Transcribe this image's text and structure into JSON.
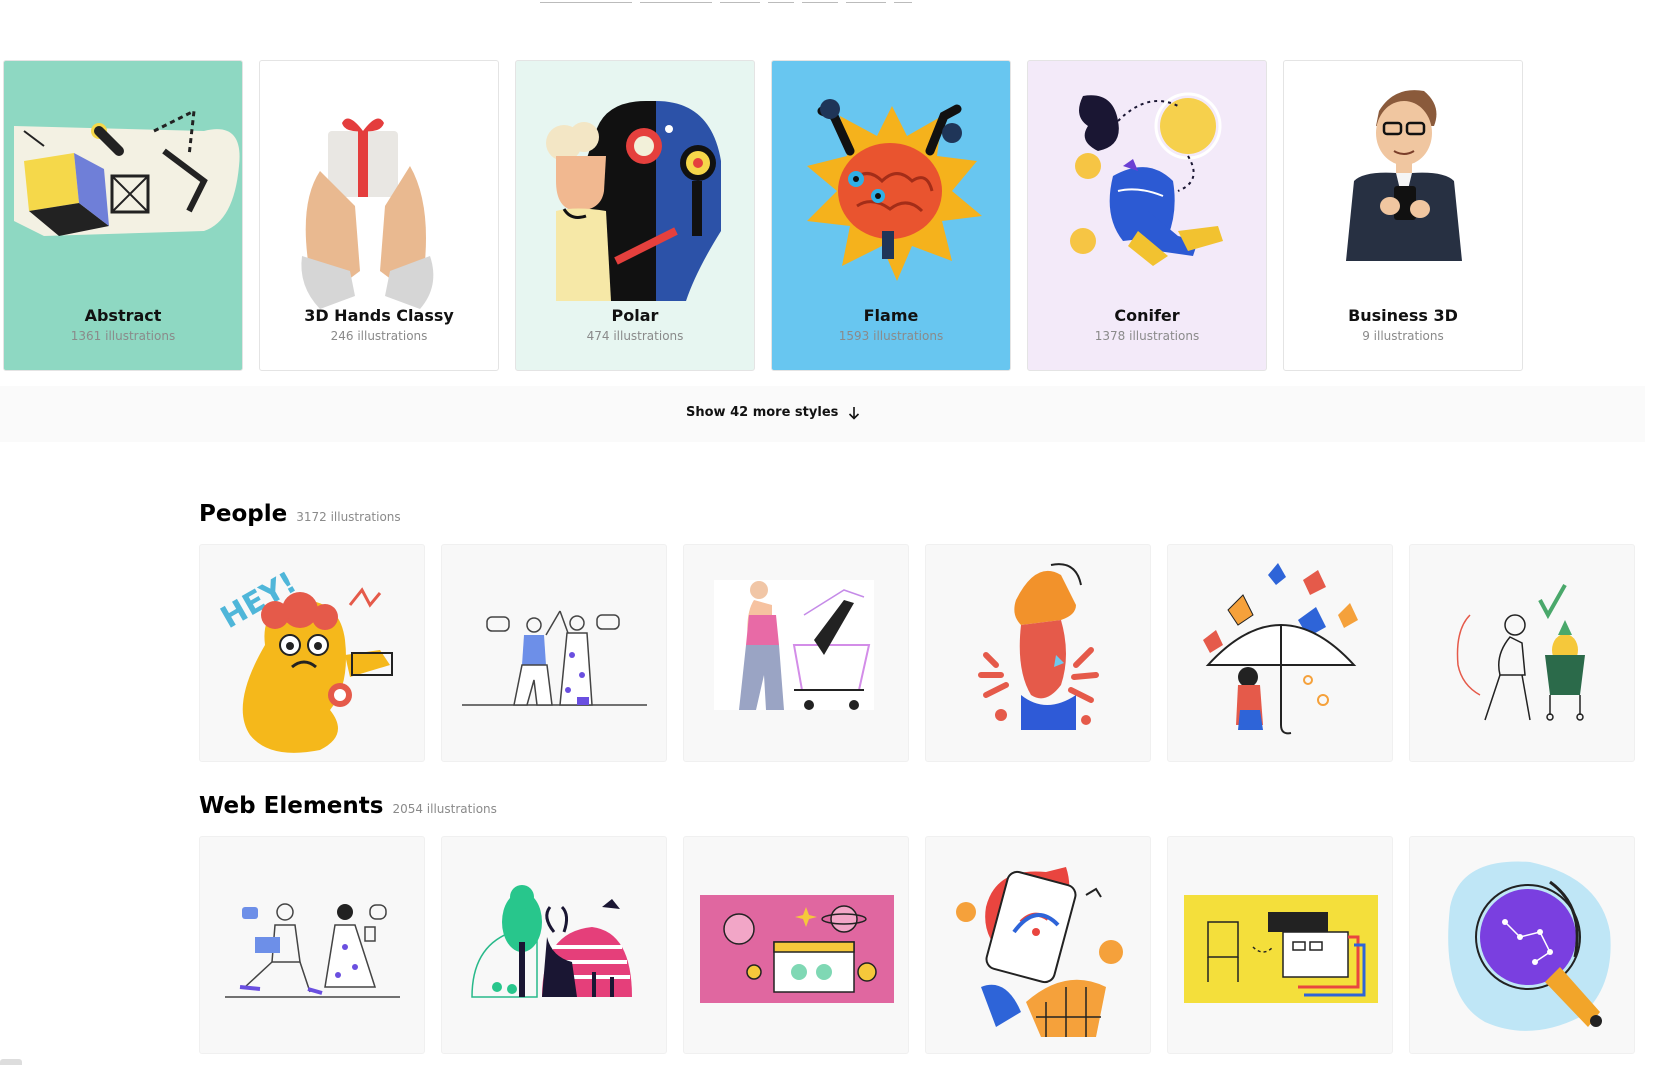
{
  "styles": [
    {
      "title": "Abstract",
      "count": "1361 illustrations",
      "bg": "#8ed8c2"
    },
    {
      "title": "3D Hands Classy",
      "count": "246 illustrations",
      "bg": "#ffffff"
    },
    {
      "title": "Polar",
      "count": "474 illustrations",
      "bg": "#e7f6f1"
    },
    {
      "title": "Flame",
      "count": "1593 illustrations",
      "bg": "#68c6f0"
    },
    {
      "title": "Conifer",
      "count": "1378 illustrations",
      "bg": "#f3eaf9"
    },
    {
      "title": "Business 3D",
      "count": "9 illustrations",
      "bg": "#ffffff"
    }
  ],
  "show_more": {
    "label": "Show 42 more styles",
    "icon": "arrow-down-icon"
  },
  "sections": [
    {
      "heading": "People",
      "count": "3172 illustrations"
    },
    {
      "heading": "Web Elements",
      "count": "2054 illustrations"
    }
  ]
}
